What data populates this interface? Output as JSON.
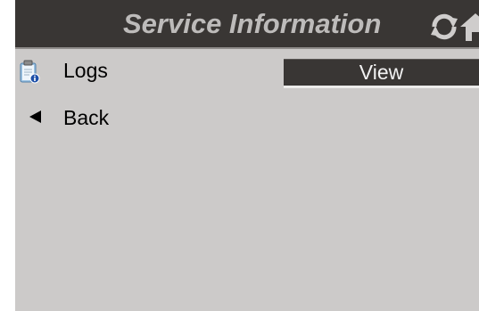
{
  "header": {
    "title": "Service Information",
    "icons": {
      "refresh": "refresh-icon",
      "home": "home-icon"
    }
  },
  "menu": {
    "logs": {
      "icon": "logs-clipboard-icon",
      "label": "Logs",
      "action_label": "View"
    },
    "back": {
      "icon": "back-arrow-icon",
      "label": "Back"
    }
  },
  "colors": {
    "header_bg": "#393634",
    "title_text": "#bdbbba",
    "panel_bg": "#cccac9",
    "button_bg": "#393634",
    "button_text": "#f2f2f2"
  }
}
